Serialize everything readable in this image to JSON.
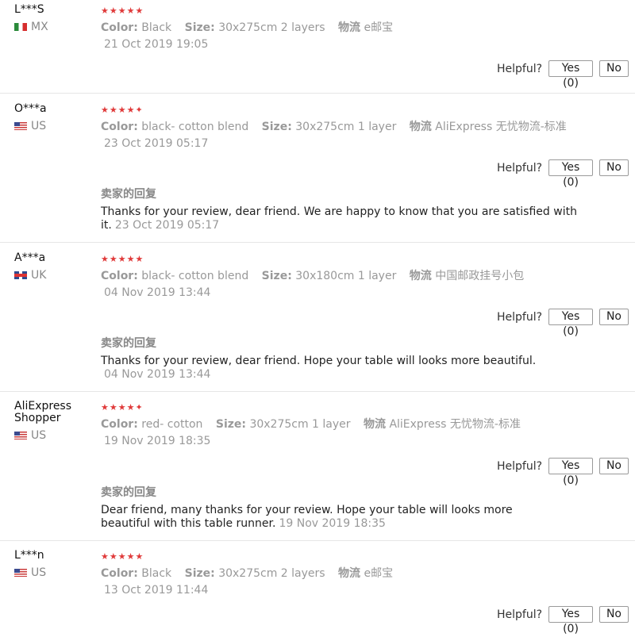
{
  "labels": {
    "color": "Color:",
    "size": "Size:",
    "logistics": "物流",
    "helpful": "Helpful?",
    "seller_reply": "卖家的回复"
  },
  "reviews": [
    {
      "user": "L***S",
      "country": "MX",
      "stars": 5,
      "color": "Black",
      "size": "30x275cm 2 layers",
      "logistics": "e邮宝",
      "date": "21 Oct 2019 19:05",
      "yes": "Yes (0)",
      "no": "No"
    },
    {
      "user": "O***a",
      "country": "US",
      "stars": 4.5,
      "color": "black- cotton blend",
      "size": "30x275cm 1 layer",
      "logistics": "AliExpress 无忧物流-标准",
      "date": "23 Oct 2019 05:17",
      "yes": "Yes (0)",
      "no": "No",
      "reply": "Thanks for your review, dear friend. We are happy to know that you are satisfied with it.",
      "reply_date": "23 Oct 2019 05:17"
    },
    {
      "user": "A***a",
      "country": "UK",
      "stars": 5,
      "color": "black- cotton blend",
      "size": "30x180cm 1 layer",
      "logistics": "中国邮政挂号小包",
      "date": "04 Nov 2019 13:44",
      "yes": "Yes (0)",
      "no": "No",
      "reply": "Thanks for your review, dear friend. Hope your table will looks more beautiful.",
      "reply_date": "04 Nov 2019 13:44"
    },
    {
      "user": "AliExpress Shopper",
      "country": "US",
      "stars": 4.5,
      "color": "red- cotton",
      "size": "30x275cm 1 layer",
      "logistics": "AliExpress 无忧物流-标准",
      "date": "19 Nov 2019 18:35",
      "yes": "Yes (0)",
      "no": "No",
      "reply": "Dear friend, many thanks for your review. Hope your table will looks more beautiful with this table runner.",
      "reply_date": "19 Nov 2019 18:35"
    },
    {
      "user": "L***n",
      "country": "US",
      "stars": 5,
      "color": "Black",
      "size": "30x275cm 2 layers",
      "logistics": "e邮宝",
      "date": "13 Oct 2019 11:44",
      "yes": "Yes (0)",
      "no": "No"
    }
  ]
}
